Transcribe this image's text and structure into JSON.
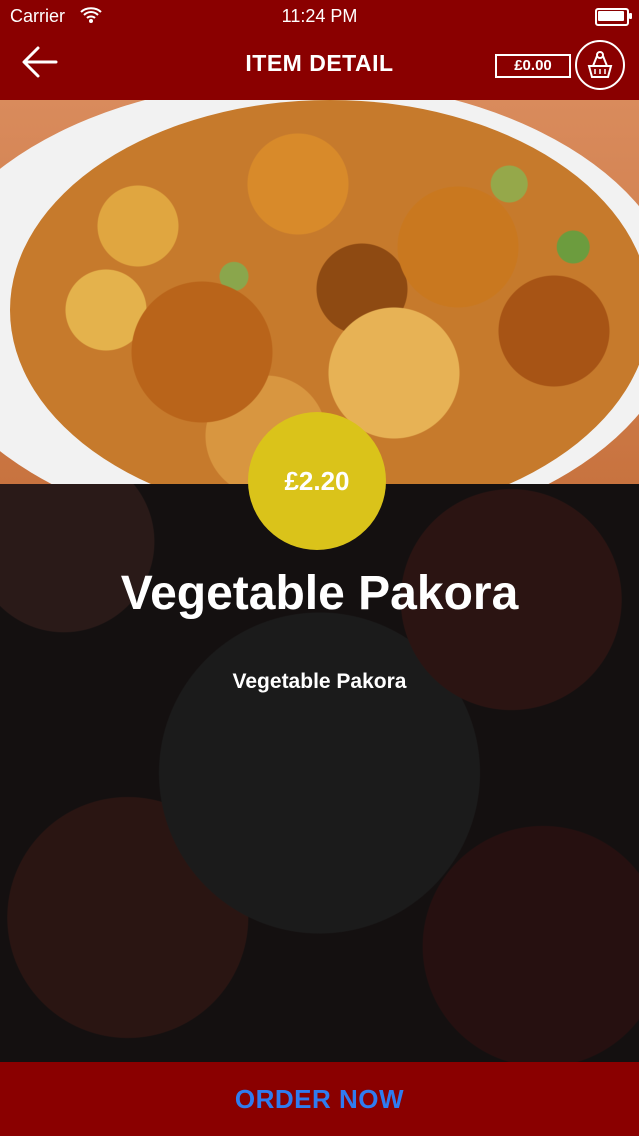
{
  "status_bar": {
    "carrier": "Carrier",
    "time": "11:24 PM"
  },
  "header": {
    "title": "ITEM DETAIL",
    "cart_total": "£0.00"
  },
  "item": {
    "price": "£2.20",
    "name": "Vegetable Pakora",
    "description": "Vegetable Pakora"
  },
  "footer": {
    "order_label": "ORDER NOW"
  },
  "colors": {
    "brand": "#8a0000",
    "price_badge": "#dac31a",
    "order_text": "#2f7cf0"
  },
  "icons": {
    "back": "back-arrow-icon",
    "cart": "basket-icon",
    "wifi": "wifi-icon",
    "battery": "battery-icon"
  }
}
